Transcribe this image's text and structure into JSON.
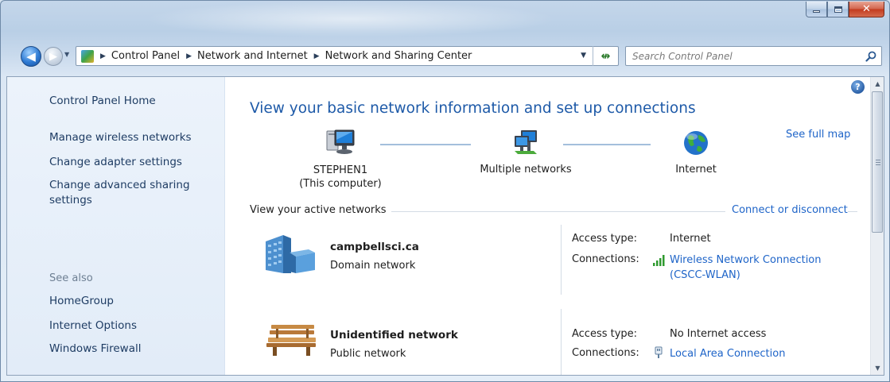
{
  "window": {
    "caption_buttons": [
      "minimize",
      "maximize",
      "close"
    ],
    "accent_close": "#c23a1e"
  },
  "address_bar": {
    "breadcrumbs": [
      "Control Panel",
      "Network and Internet",
      "Network and Sharing Center"
    ]
  },
  "search": {
    "placeholder": "Search Control Panel"
  },
  "sidebar": {
    "home": "Control Panel Home",
    "tasks": [
      {
        "label": "Manage wireless networks"
      },
      {
        "label": "Change adapter settings"
      },
      {
        "label": "Change advanced sharing settings"
      }
    ],
    "see_also_heading": "See also",
    "see_also": [
      {
        "label": "HomeGroup"
      },
      {
        "label": "Internet Options"
      },
      {
        "label": "Windows Firewall"
      }
    ]
  },
  "main": {
    "title": "View your basic network information and set up connections",
    "see_full_map": "See full map",
    "map": {
      "computer_name": "STEPHEN1",
      "computer_sub": "(This computer)",
      "middle": "Multiple networks",
      "internet": "Internet"
    },
    "active_networks_label": "View your active networks",
    "connect_link": "Connect or disconnect",
    "networks": [
      {
        "name": "campbellsci.ca",
        "category": "Domain network",
        "access_label": "Access type:",
        "access_value": "Internet",
        "connections_label": "Connections:",
        "connection_link_line1": "Wireless Network Connection",
        "connection_link_line2": "(CSCC-WLAN)",
        "icon": "domain-building-icon"
      },
      {
        "name": "Unidentified network",
        "category": "Public network",
        "access_label": "Access type:",
        "access_value": "No Internet access",
        "connections_label": "Connections:",
        "connection_link_line1": "Local Area Connection",
        "icon": "park-bench-icon"
      }
    ]
  },
  "colors": {
    "link": "#1e64c8",
    "title": "#1e5aa8",
    "sidebar_bg": "#e2ecf8"
  }
}
